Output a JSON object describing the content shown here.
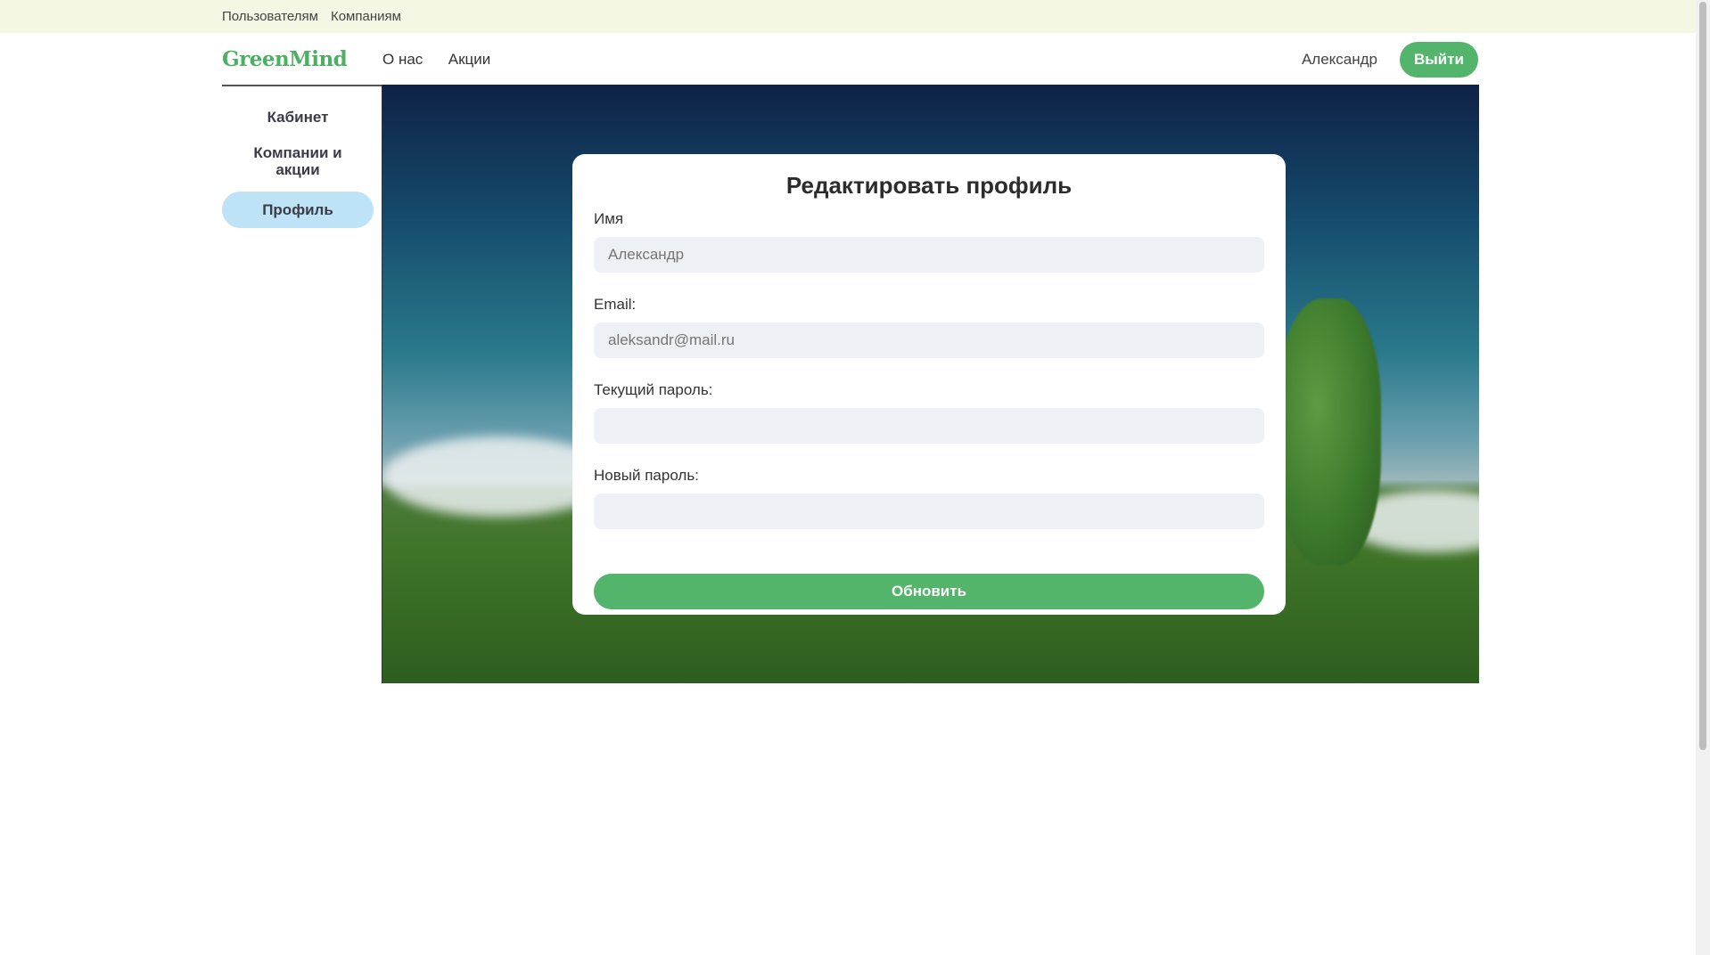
{
  "topbar": {
    "links": [
      "Пользователям",
      "Компаниям"
    ]
  },
  "header": {
    "logo": "GreenMind",
    "nav": [
      "О нас",
      "Акции"
    ],
    "username": "Александр",
    "logout_label": "Выйти"
  },
  "sidebar": {
    "items": [
      {
        "label": "Кабинет",
        "active": false
      },
      {
        "label": "Компании и акции",
        "active": false
      },
      {
        "label": "Профиль",
        "active": true
      }
    ]
  },
  "form": {
    "title": "Редактировать профиль",
    "fields": [
      {
        "label": "Имя",
        "value": "",
        "placeholder": "Александр"
      },
      {
        "label": "Email:",
        "value": "",
        "placeholder": "aleksandr@mail.ru"
      },
      {
        "label": "Текущий пароль:",
        "value": "",
        "placeholder": ""
      },
      {
        "label": "Новый пароль:",
        "value": "",
        "placeholder": ""
      }
    ],
    "submit_label": "Обновить"
  },
  "colors": {
    "accent": "#53b56b",
    "topbar_bg": "#f3f7e4",
    "active_nav": "#bfe3f6",
    "input_bg": "#edf0f4"
  }
}
